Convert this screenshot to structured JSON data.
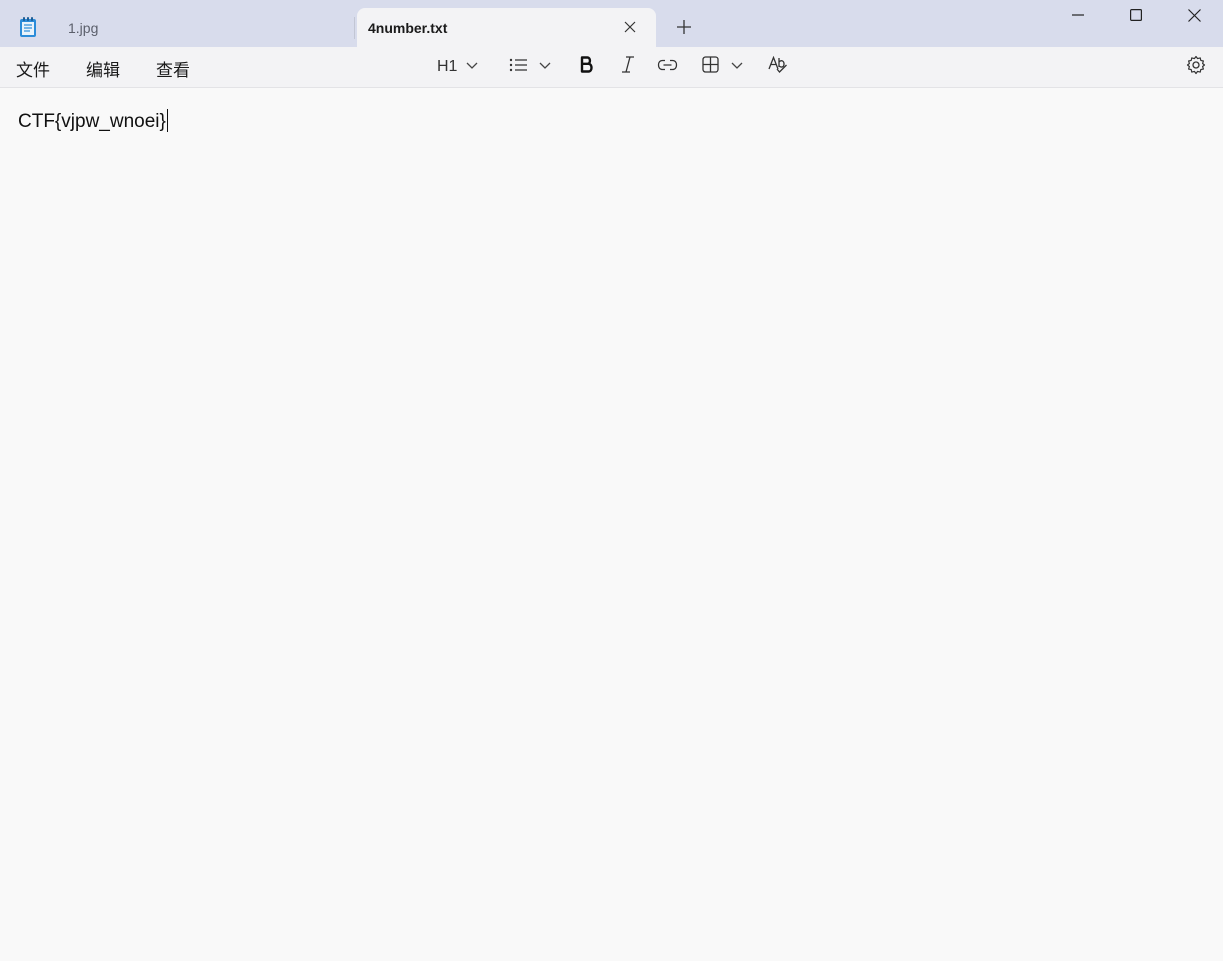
{
  "window": {
    "app_icon": "notepad-icon",
    "controls": [
      "minimize-icon",
      "maximize-icon",
      "close-icon"
    ]
  },
  "tabs": [
    {
      "label": "1.jpg",
      "active": false
    },
    {
      "label": "4number.txt",
      "active": true
    }
  ],
  "menu": {
    "file": "文件",
    "edit": "编辑",
    "view": "查看"
  },
  "toolbar": {
    "heading_label": "H1",
    "icons": [
      "chevron-down-icon",
      "list-icon",
      "bold-icon",
      "italic-icon",
      "link-icon",
      "table-icon",
      "spellcheck-icon",
      "settings-icon"
    ]
  },
  "editor": {
    "content": "CTF{vjpw_wnoei}"
  },
  "colors": {
    "titlebar": "#d8dcec",
    "active_tab": "#f3f3f5",
    "editor_bg": "#f9f9f9"
  }
}
